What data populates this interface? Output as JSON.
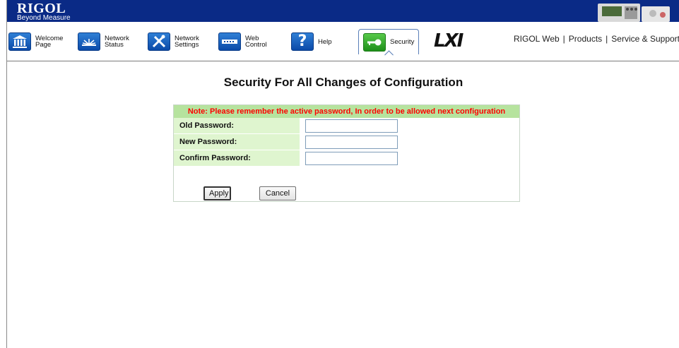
{
  "brand": {
    "logo_text": "RIGOL",
    "tagline": "Beyond Measure"
  },
  "nav": {
    "items": [
      {
        "label": "Welcome\nPage",
        "icon": "building-icon"
      },
      {
        "label": "Network\nStatus",
        "icon": "network-status-icon"
      },
      {
        "label": "Network\nSettings",
        "icon": "tools-icon"
      },
      {
        "label": "Web\nControl",
        "icon": "web-control-icon"
      },
      {
        "label": "Help",
        "icon": "help-icon"
      },
      {
        "label": "Security",
        "icon": "key-icon",
        "active": true
      }
    ],
    "lxi_logo": "LXI"
  },
  "top_links": {
    "rigol_web": "RIGOL Web",
    "products": "Products",
    "service": "Service & Support",
    "separator": "|"
  },
  "main": {
    "title": "Security For All Changes of Configuration",
    "note": "Note: Please remember the active password, In order to be allowed next configuration",
    "fields": {
      "old_password": {
        "label": "Old Password:",
        "value": ""
      },
      "new_password": {
        "label": "New Password:",
        "value": ""
      },
      "confirm_password": {
        "label": "Confirm Password:",
        "value": ""
      }
    },
    "apply_label": "Apply",
    "cancel_label": "Cancel"
  },
  "colors": {
    "banner": "#0a2a86",
    "note_bg": "#b6e39e",
    "note_text": "#ff0000",
    "label_bg": "#dff5cf"
  }
}
